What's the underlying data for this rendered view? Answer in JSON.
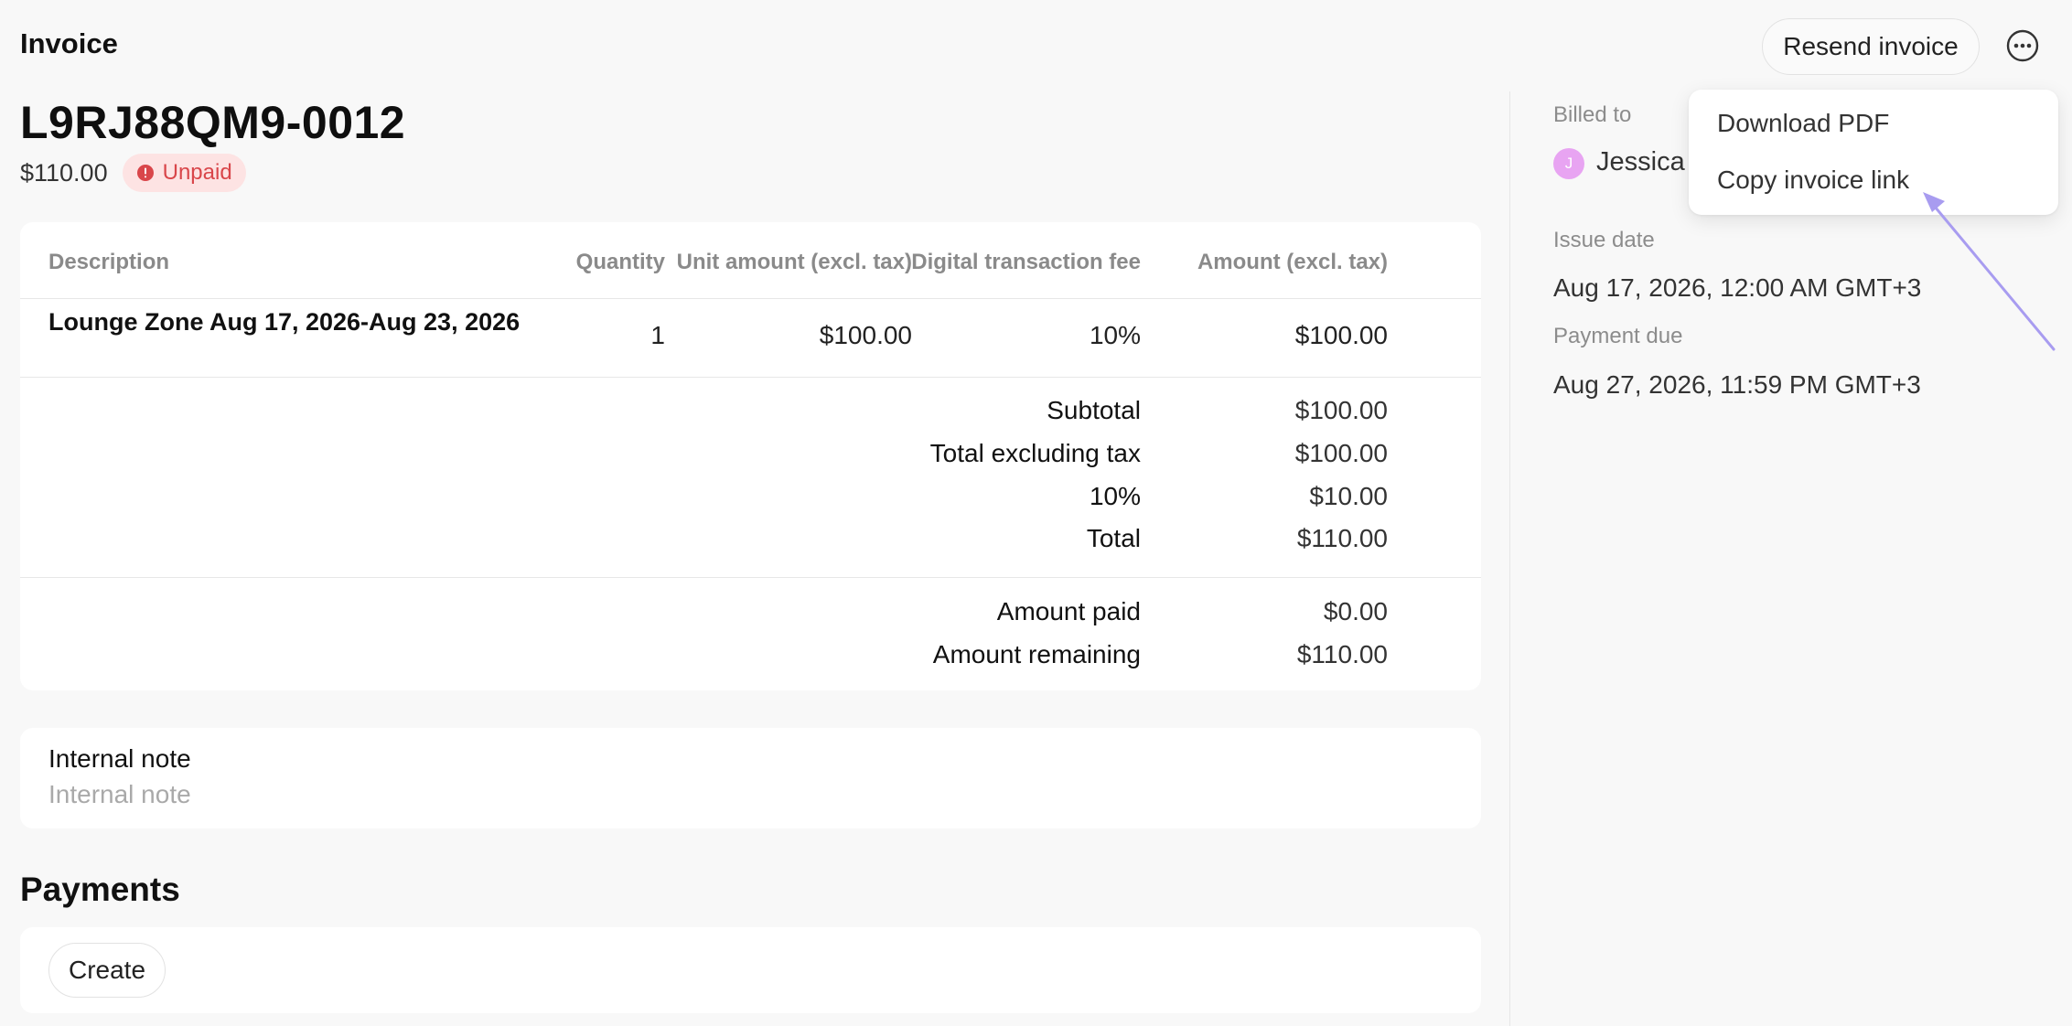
{
  "header": {
    "title": "Invoice",
    "resend_label": "Resend invoice",
    "more_icon": "ellipsis-circle-icon"
  },
  "invoice": {
    "id": "L9RJ88QM9-0012",
    "amount": "$110.00",
    "status": "Unpaid",
    "status_color": "#d9464a"
  },
  "table": {
    "headers": {
      "description": "Description",
      "quantity": "Quantity",
      "unit_amount": "Unit amount (excl. tax)",
      "fee": "Digital transaction fee",
      "amount": "Amount (excl. tax)"
    },
    "rows": [
      {
        "description": "Lounge Zone Aug 17, 2026-Aug 23, 2026",
        "quantity": "1",
        "unit_amount": "$100.00",
        "fee": "10%",
        "amount": "$100.00"
      }
    ],
    "summary": [
      {
        "label": "Subtotal",
        "value": "$100.00"
      },
      {
        "label": "Total excluding tax",
        "value": "$100.00"
      },
      {
        "label": "10%",
        "value": "$10.00"
      },
      {
        "label": "Total",
        "value": "$110.00"
      }
    ],
    "payment_summary": [
      {
        "label": "Amount paid",
        "value": "$0.00"
      },
      {
        "label": "Amount remaining",
        "value": "$110.00"
      }
    ]
  },
  "note": {
    "label": "Internal note",
    "placeholder": "Internal note"
  },
  "payments": {
    "title": "Payments",
    "create_label": "Create"
  },
  "sidebar": {
    "billed_to_label": "Billed to",
    "billed_to_initial": "J",
    "billed_to_name": "Jessica",
    "issue_date_label": "Issue date",
    "issue_date": "Aug 17, 2026, 12:00 AM GMT+3",
    "payment_due_label": "Payment due",
    "payment_due": "Aug 27, 2026, 11:59 PM GMT+3"
  },
  "dropdown": {
    "items": [
      "Download PDF",
      "Copy invoice link"
    ]
  },
  "colors": {
    "accent_arrow": "#a89cf0",
    "avatar": "#e8a4f2",
    "badge_bg": "#fde3e3"
  }
}
